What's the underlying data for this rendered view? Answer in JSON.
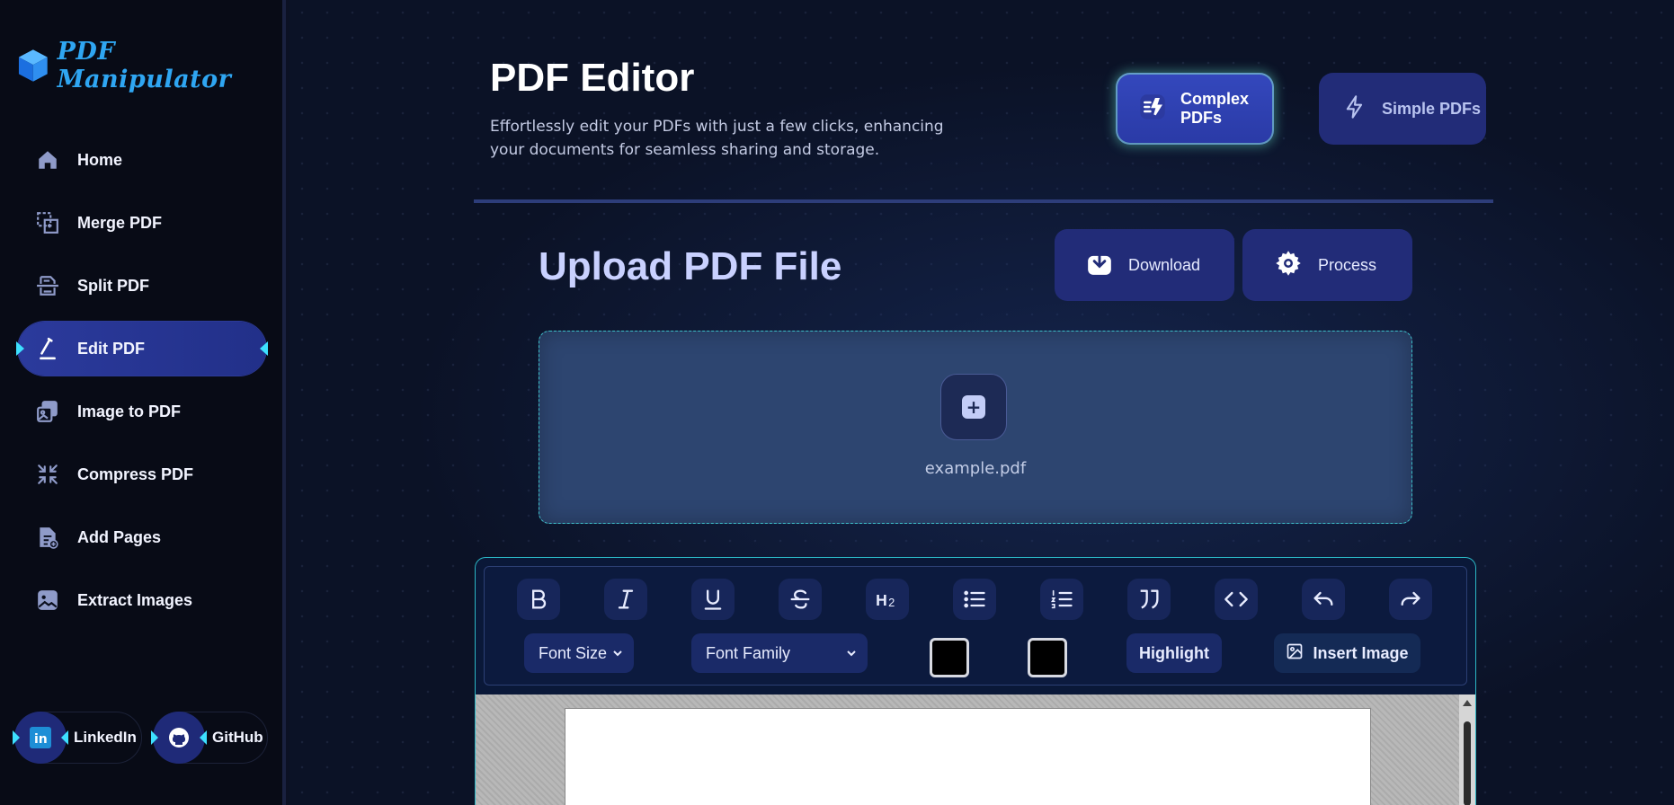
{
  "brand": {
    "name": "PDF Manipulator",
    "color": "#2fa6f2"
  },
  "sidebar": {
    "items": [
      {
        "label": "Home",
        "icon": "home-icon"
      },
      {
        "label": "Merge PDF",
        "icon": "merge-icon"
      },
      {
        "label": "Split PDF",
        "icon": "split-icon"
      },
      {
        "label": "Edit PDF",
        "icon": "pen-icon",
        "active": true
      },
      {
        "label": "Image to PDF",
        "icon": "image-stack-icon"
      },
      {
        "label": "Compress PDF",
        "icon": "compress-icon"
      },
      {
        "label": "Add Pages",
        "icon": "add-file-icon"
      },
      {
        "label": "Extract Images",
        "icon": "image-icon"
      }
    ],
    "social": [
      {
        "label": "LinkedIn",
        "icon": "linkedin-icon"
      },
      {
        "label": "GitHub",
        "icon": "github-icon"
      }
    ]
  },
  "header": {
    "title": "PDF Editor",
    "description": "Effortlessly edit your PDFs with just a few clicks, enhancing your documents for seamless sharing and storage.",
    "modes": [
      {
        "label": "Complex PDFs",
        "icon": "bolt-list-icon",
        "active": true
      },
      {
        "label": "Simple PDFs",
        "icon": "bolt-icon"
      }
    ]
  },
  "upload": {
    "title": "Upload PDF File",
    "download_label": "Download",
    "process_label": "Process",
    "file_name": "example.pdf",
    "add_icon": "plus-icon"
  },
  "toolbar": {
    "buttons": [
      "bold-icon",
      "italic-icon",
      "underline-icon",
      "strikethrough-icon",
      "heading-2-icon",
      "bullet-list-icon",
      "ordered-list-icon",
      "blockquote-icon",
      "code-icon",
      "undo-icon",
      "redo-icon"
    ],
    "font_size_label": "Font Size",
    "font_family_label": "Font Family",
    "text_color": "#000000",
    "highlight_color": "#000000",
    "highlight_label": "Highlight",
    "insert_image_label": "Insert Image"
  },
  "colors": {
    "accent": "#3de0ff",
    "active_nav": "#2b3a9c",
    "button": "#222c78"
  }
}
